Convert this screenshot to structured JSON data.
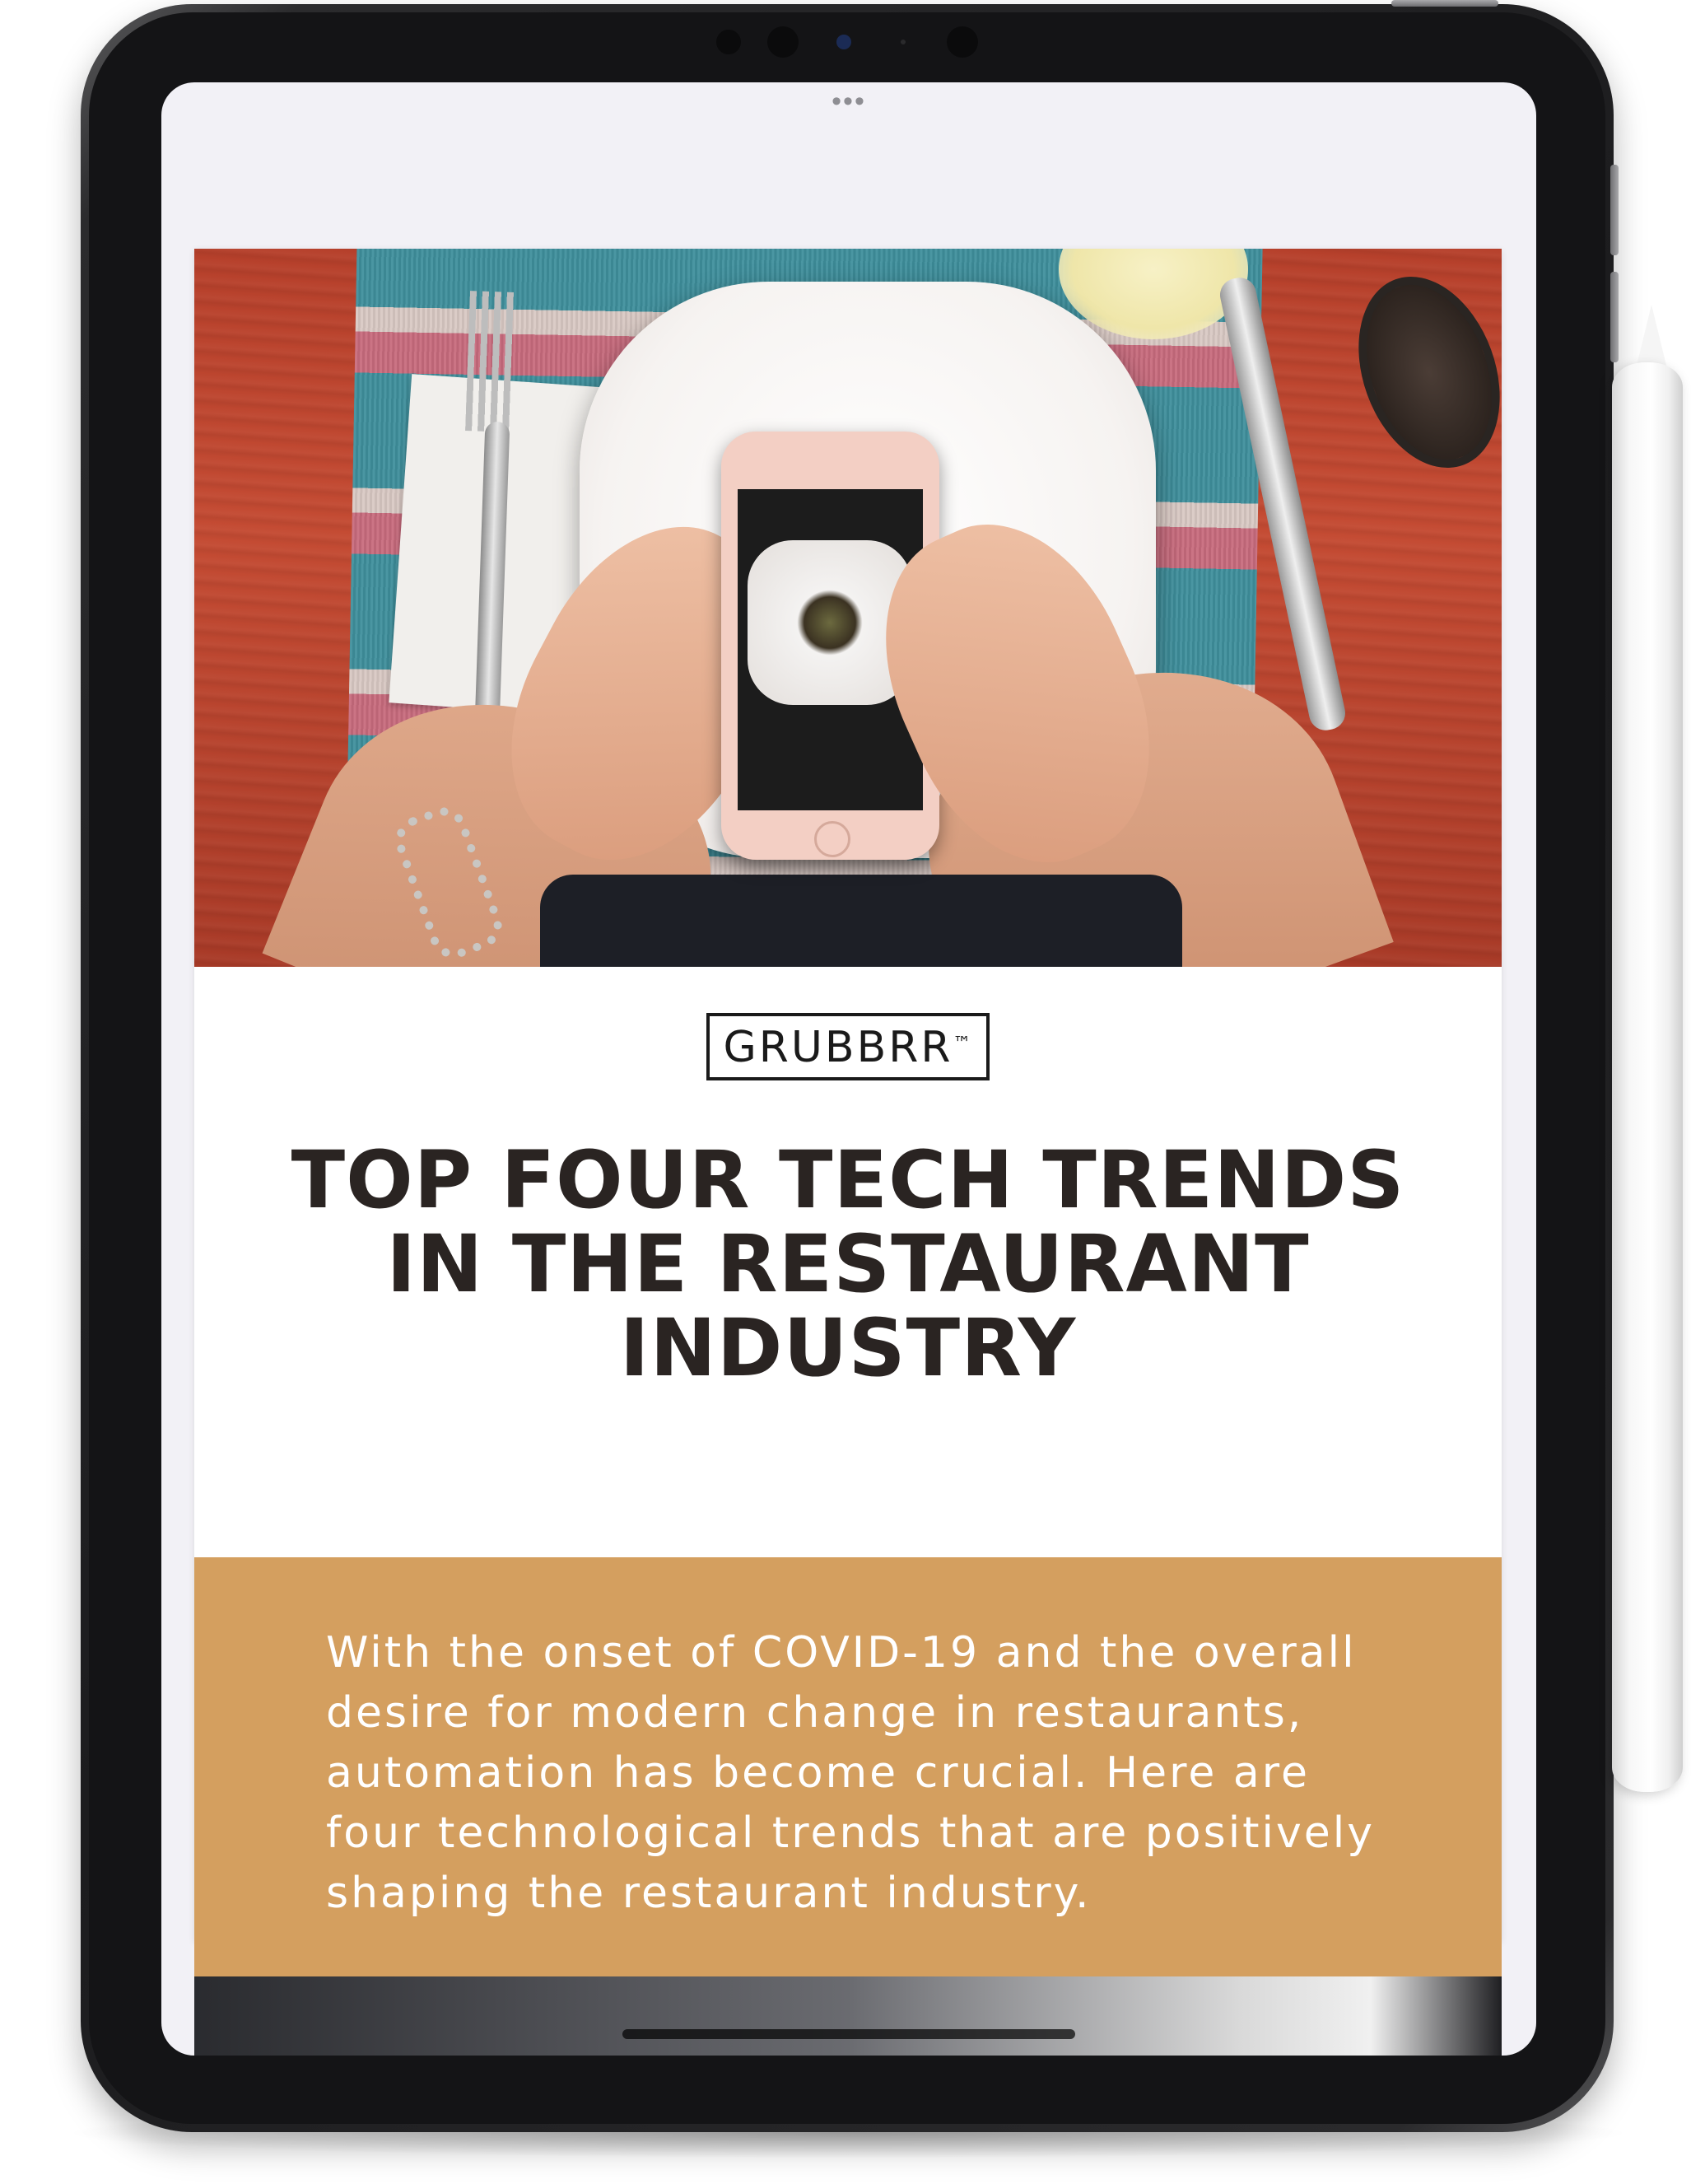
{
  "app": {
    "multitask_indicator": "•••"
  },
  "article": {
    "hero_image_alt": "Hands photographing a plated dish with a smartphone",
    "logo_text": "GRUBBRR",
    "logo_mark": "™",
    "title": "TOP FOUR TECH TRENDS IN THE RESTAURANT INDUSTRY",
    "intro": "With the onset of COVID-19 and the overall desire for modern change in restaurants, automation has become crucial. Here are four technological trends that are positively shaping the restaurant industry."
  },
  "colors": {
    "intro_background": "#d49f5f",
    "title_text": "#2a2422",
    "screen_background": "#f2f1f6",
    "device_frame": "#1c1c1e"
  },
  "icons": {
    "device": "tablet",
    "stylus": "pencil-icon"
  }
}
